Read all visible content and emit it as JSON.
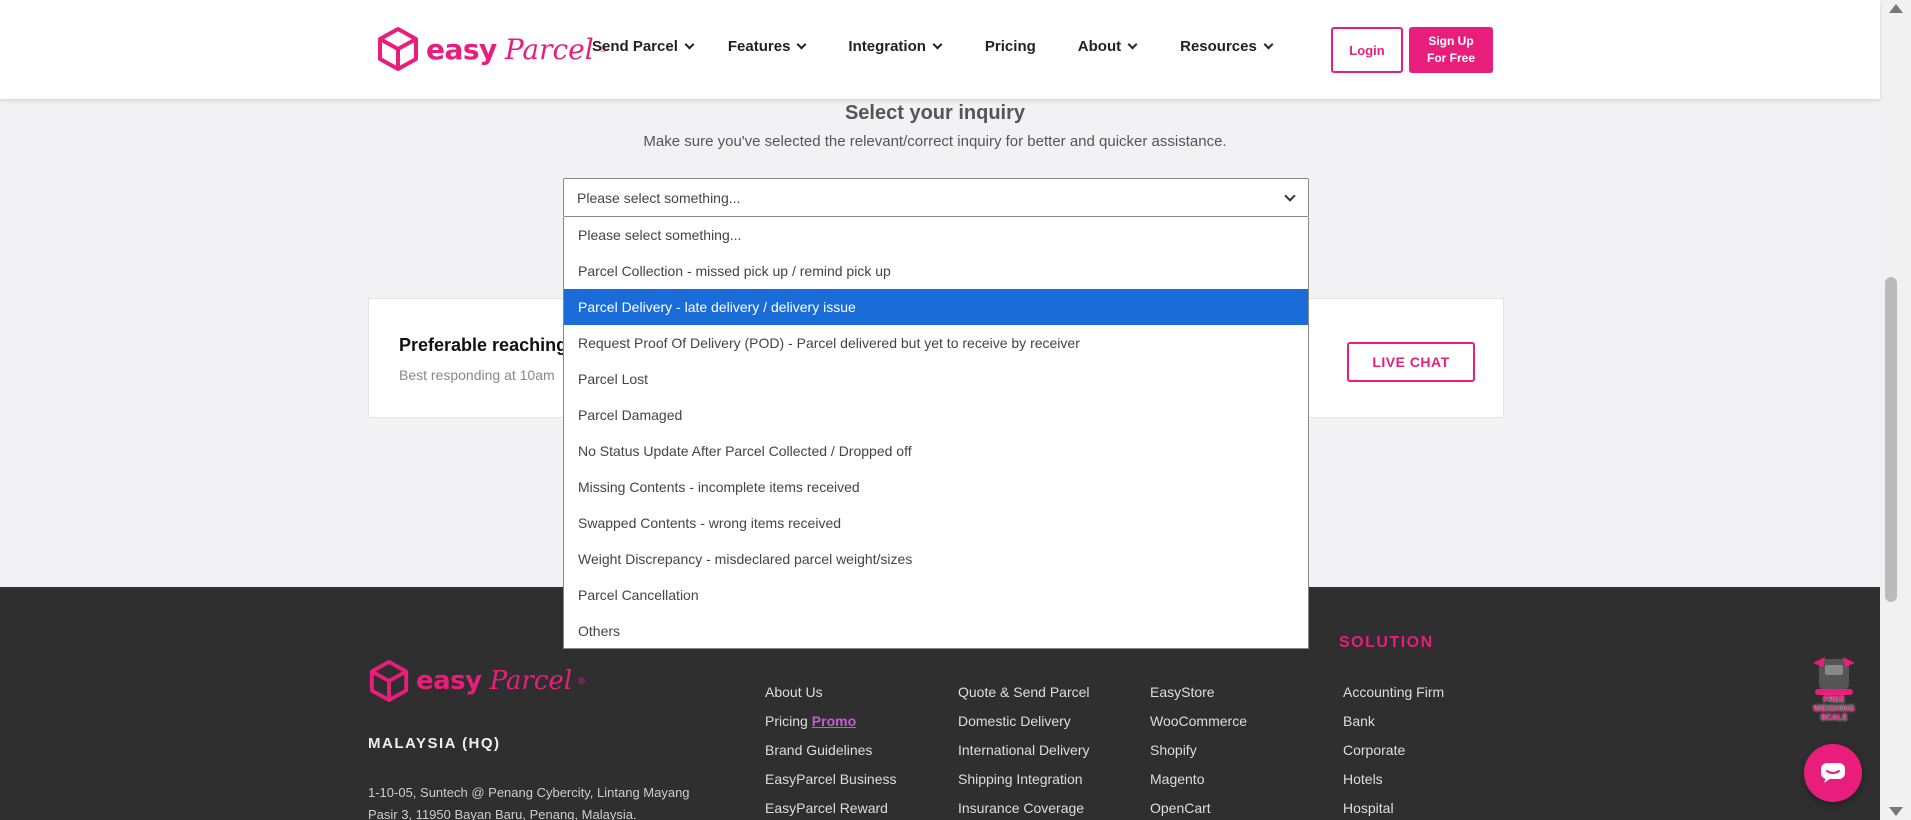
{
  "header": {
    "logo_text": "easy",
    "logo_script": "Parcel",
    "logo_reg": "®",
    "nav": [
      {
        "label": "Send Parcel",
        "dropdown": true
      },
      {
        "label": "Features",
        "dropdown": true
      },
      {
        "label": "Integration",
        "dropdown": true
      },
      {
        "label": "Pricing",
        "dropdown": false
      },
      {
        "label": "About",
        "dropdown": true
      },
      {
        "label": "Resources",
        "dropdown": true
      }
    ],
    "login_label": "Login",
    "signup_line1": "Sign Up",
    "signup_line2": "For Free"
  },
  "main": {
    "title": "Select your inquiry",
    "subtitle": "Make sure you've selected the relevant/correct inquiry for better and quicker assistance.",
    "select_value": "Please select something...",
    "options": [
      "Please select something...",
      "Parcel Collection - missed pick up / remind pick up",
      "Parcel Delivery - late delivery / delivery issue",
      "Request Proof Of Delivery (POD) - Parcel delivered but yet to receive by receiver",
      "Parcel Lost",
      "Parcel Damaged",
      "No Status Update After Parcel Collected / Dropped off",
      "Missing Contents - incomplete items received",
      "Swapped Contents - wrong items received",
      "Weight Discrepancy - misdeclared parcel weight/sizes",
      "Parcel Cancellation",
      "Others"
    ],
    "highlighted_option_index": 2
  },
  "contact_card": {
    "title": "Preferable reaching t",
    "subtitle": "Best responding at 10am",
    "live_chat_label": "LIVE CHAT"
  },
  "footer": {
    "hq_label": "MALAYSIA (HQ)",
    "address_line1": "1-10-05, Suntech @ Penang Cybercity, Lintang Mayang",
    "address_line2": "Pasir 3, 11950 Bayan Baru, Penang, Malaysia.",
    "col1": [
      "About Us",
      "Pricing",
      "Brand Guidelines",
      "EasyParcel Business",
      "EasyParcel Reward"
    ],
    "promo_label": "Promo",
    "col2": [
      "Quote & Send Parcel",
      "Domestic Delivery",
      "International Delivery",
      "Shipping Integration",
      "Insurance Coverage"
    ],
    "col3": [
      "EasyStore",
      "WooCommerce",
      "Shopify",
      "Magento",
      "OpenCart"
    ],
    "solution_heading": "SOLUTION",
    "col4": [
      "Accounting Firm",
      "Bank",
      "Corporate",
      "Hotels",
      "Hospital"
    ]
  },
  "widgets": {
    "weighing_label_1": "FREE",
    "weighing_label_2": "WEIGHING",
    "weighing_label_3": "SCALE"
  },
  "colors": {
    "brand_pink": "#e91e7c",
    "selected_blue": "#1a6cd8",
    "footer_bg": "#2f2f2f"
  }
}
